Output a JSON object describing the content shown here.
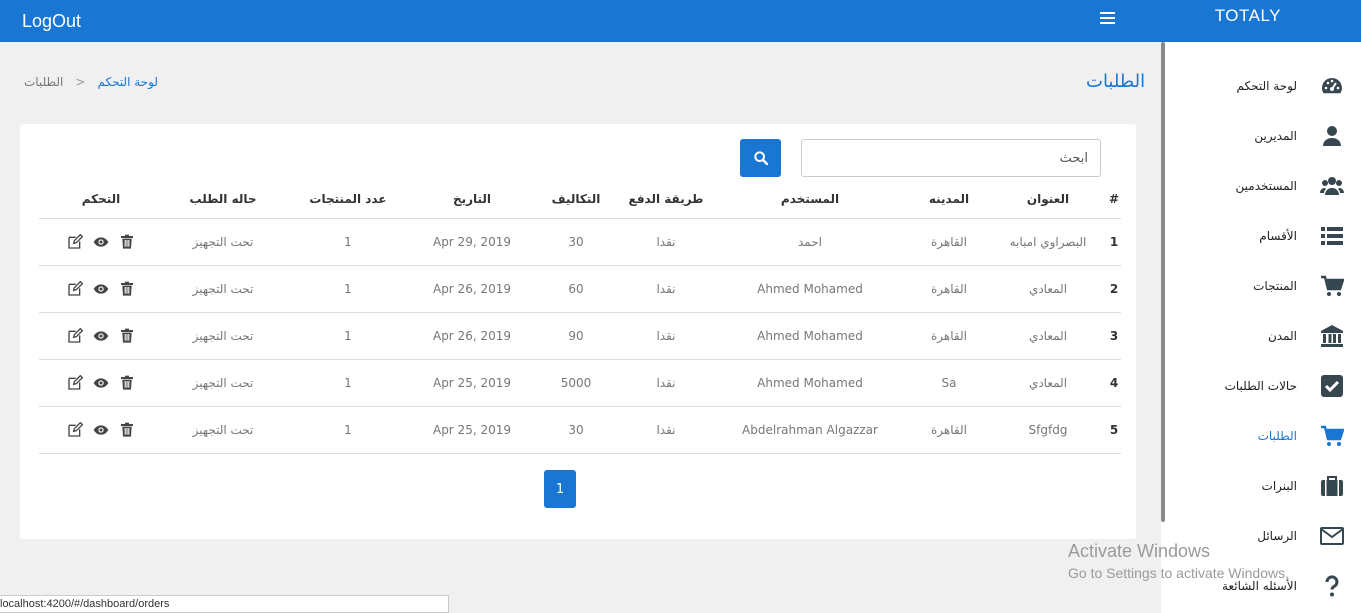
{
  "topbar": {
    "logout_label": "LogOut",
    "brand": "TOTALY",
    "accent": "#1976d2"
  },
  "sidebar": {
    "items": [
      {
        "label": "لوحة التحكم",
        "icon": "dashboard-icon"
      },
      {
        "label": "المديرين",
        "icon": "user-icon"
      },
      {
        "label": "المستخدمين",
        "icon": "users-icon"
      },
      {
        "label": "الأقسام",
        "icon": "list-icon"
      },
      {
        "label": "المنتجات",
        "icon": "cart-icon"
      },
      {
        "label": "المدن",
        "icon": "bank-icon"
      },
      {
        "label": "حالات الطلبات",
        "icon": "check-square-icon"
      },
      {
        "label": "الطلبات",
        "icon": "cart-icon",
        "active": true
      },
      {
        "label": "البنرات",
        "icon": "briefcase-icon"
      },
      {
        "label": "الرسائل",
        "icon": "envelope-icon"
      },
      {
        "label": "الأسئله الشائعة",
        "icon": "question-icon"
      }
    ]
  },
  "page": {
    "title": "الطلبات",
    "breadcrumb": {
      "link": "لوحة التحكم",
      "separator": ">",
      "current": "الطلبات"
    }
  },
  "search": {
    "placeholder": "ابحث"
  },
  "table": {
    "headers": {
      "num": "#",
      "address": "العنوان",
      "city": "المدينه",
      "user": "المستخدم",
      "payment": "طريقة الدفع",
      "cost": "التكاليف",
      "date": "التاريخ",
      "products": "عدد المنتجات",
      "status": "حاله الطلب",
      "control": "التحكم"
    },
    "rows": [
      {
        "num": "1",
        "address": "البصراوي امبابه",
        "city": "القاهرة",
        "user": "احمد",
        "payment": "نقدا",
        "cost": "30",
        "date": "Apr 29, 2019",
        "products": "1",
        "status": "تحت التجهيز"
      },
      {
        "num": "2",
        "address": "المعادي",
        "city": "القاهرة",
        "user": "Ahmed Mohamed",
        "payment": "نقدا",
        "cost": "60",
        "date": "Apr 26, 2019",
        "products": "1",
        "status": "تحت التجهيز"
      },
      {
        "num": "3",
        "address": "المعادي",
        "city": "القاهرة",
        "user": "Ahmed Mohamed",
        "payment": "نقدا",
        "cost": "90",
        "date": "Apr 26, 2019",
        "products": "1",
        "status": "تحت التجهيز"
      },
      {
        "num": "4",
        "address": "المعادي",
        "city": "Sa",
        "user": "Ahmed Mohamed",
        "payment": "نقدا",
        "cost": "5000",
        "date": "Apr 25, 2019",
        "products": "1",
        "status": "تحت التجهيز"
      },
      {
        "num": "5",
        "address": "Sfgfdg",
        "city": "القاهرة",
        "user": "Abdelrahman Algazzar",
        "payment": "نقدا",
        "cost": "30",
        "date": "Apr 25, 2019",
        "products": "1",
        "status": "تحت التجهيز"
      }
    ]
  },
  "pagination": {
    "current": "1"
  },
  "statusbar": {
    "url": "localhost:4200/#/dashboard/orders"
  },
  "watermark": {
    "line1": "Activate Windows",
    "line2": "Go to Settings to activate Windows."
  }
}
